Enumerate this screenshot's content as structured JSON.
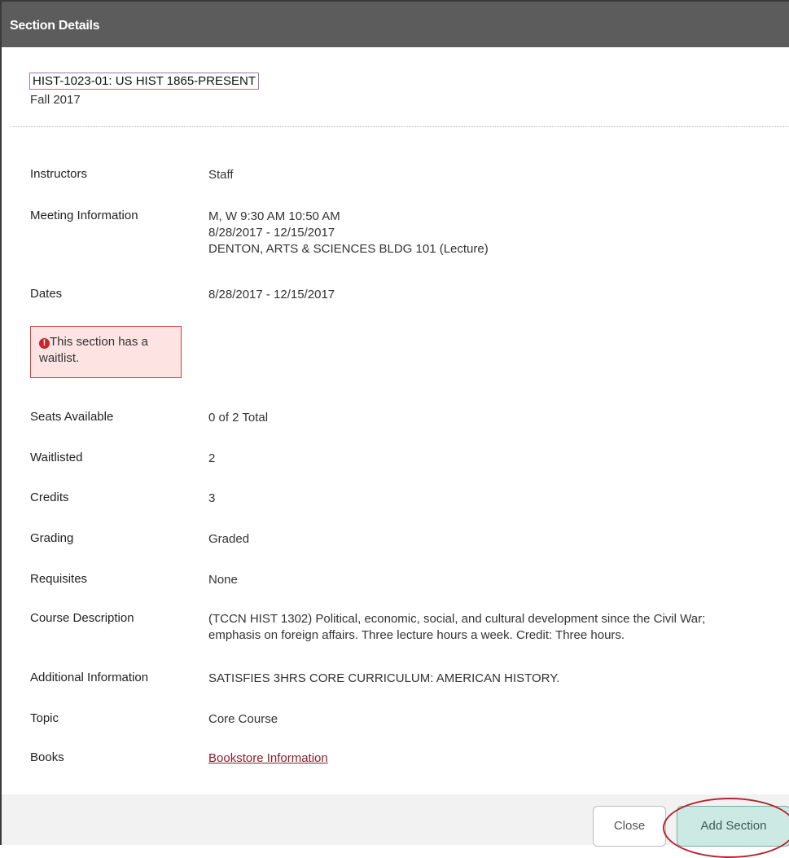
{
  "dialog": {
    "title": "Section Details"
  },
  "section": {
    "heading": "HIST-1023-01: US HIST 1865-PRESENT",
    "term": "Fall 2017"
  },
  "details": {
    "instructors": {
      "label": "Instructors",
      "value": "Staff"
    },
    "meeting": {
      "label": "Meeting Information",
      "line1": "M, W 9:30 AM 10:50 AM",
      "line2": "8/28/2017 - 12/15/2017",
      "line3": "DENTON, ARTS & SCIENCES BLDG 101 (Lecture)"
    },
    "dates": {
      "label": "Dates",
      "value": "8/28/2017 - 12/15/2017"
    },
    "waitlist_alert": {
      "icon": "exclamation-circle-icon",
      "text": "This section has a waitlist."
    },
    "seats": {
      "label": "Seats Available",
      "value": "0 of 2 Total"
    },
    "waitlisted": {
      "label": "Waitlisted",
      "value": "2"
    },
    "credits": {
      "label": "Credits",
      "value": "3"
    },
    "grading": {
      "label": "Grading",
      "value": "Graded"
    },
    "requisites": {
      "label": "Requisites",
      "value": "None"
    },
    "description": {
      "label": "Course Description",
      "line1": "(TCCN HIST 1302) Political, economic, social, and cultural development since the Civil War;",
      "line2": "emphasis on foreign affairs. Three lecture hours a week. Credit: Three hours."
    },
    "additional": {
      "label": "Additional Information",
      "value": "SATISFIES 3HRS CORE CURRICULUM: AMERICAN HISTORY."
    },
    "topic": {
      "label": "Topic",
      "value": "Core Course"
    },
    "books": {
      "label": "Books",
      "link": "Bookstore Information"
    }
  },
  "footer": {
    "close_label": "Close",
    "add_label": "Add Section"
  },
  "colors": {
    "titlebar": "#5c5c5c",
    "alert_bg": "#fde3e1",
    "alert_border": "#d34141",
    "link": "#8b1e2b",
    "add_button": "#cde9e4",
    "highlight_ring": "#b5222c"
  }
}
